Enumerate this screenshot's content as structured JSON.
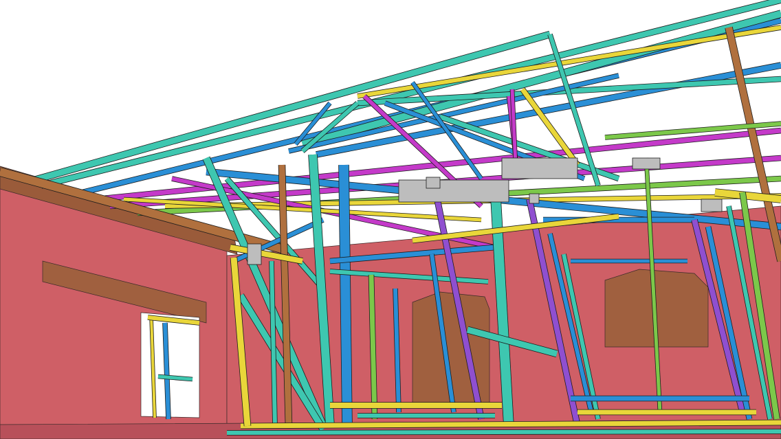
{
  "viewer": {
    "description_visible": false
  },
  "palette": {
    "background": "#ffffff",
    "wall": "#cf5f66",
    "wall_shade": "#b8505a",
    "slab": "#9a5b3a",
    "window_reveal": "#a0603f",
    "steel_teal": "#3ec7b0",
    "steel_blue": "#2a8fd6",
    "steel_yellow": "#e9d63a",
    "steel_magenta": "#c43ac9",
    "steel_purple": "#8f4fd0",
    "steel_green": "#7cc84a",
    "timber_brown": "#b0703e",
    "connector_grey": "#bdbdbd",
    "outline": "#1c1c1c"
  }
}
